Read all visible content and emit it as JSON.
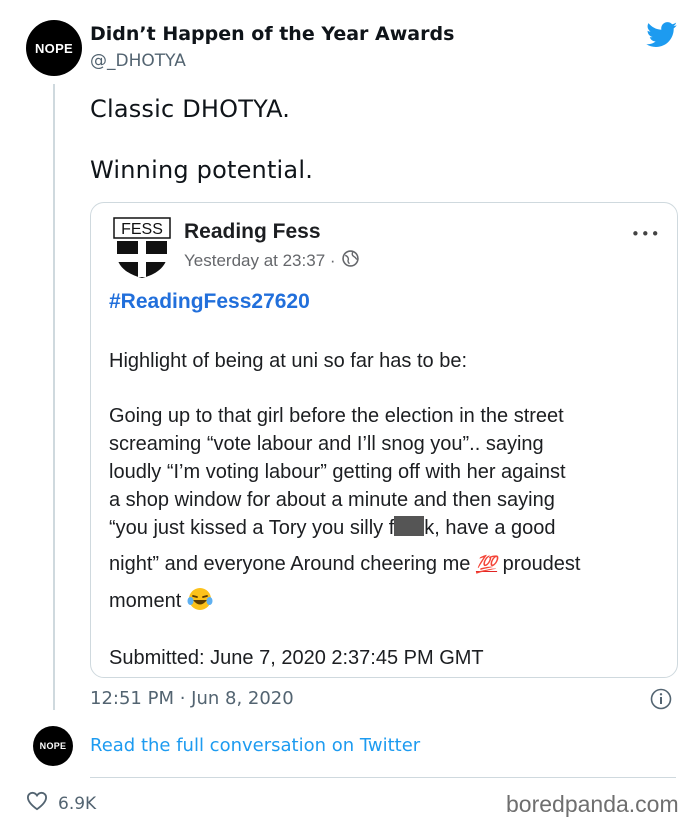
{
  "account": {
    "avatar_text": "NOPE",
    "name": "Didn’t Happen of the Year Awards",
    "handle": "@_DHOTYA"
  },
  "tweet": {
    "line1": "Classic DHOTYA.",
    "line2": "Winning potential.",
    "time": "12:51 PM · Jun 8, 2020"
  },
  "embedded_post": {
    "page_logo_text": "FESS",
    "page_name": "Reading Fess",
    "meta": "Yesterday at 23:37 ·",
    "more": "•••",
    "hashtag": "#ReadingFess27620",
    "intro": "Highlight of being at uni so far has to be:",
    "body_l1": "Going up to that girl before the election in the street",
    "body_l2": "screaming “vote labour and I’ll snog you”.. saying",
    "body_l3": "loudly “I’m voting labour” getting off with her against",
    "body_l4": "a shop window for about a minute and then saying",
    "body_l5a": "“you just kissed a Tory you silly f",
    "body_l5b": "k, have a good",
    "body_l6a": "night” and everyone Around cheering me",
    "body_l6b": "proudest",
    "body_l7": "moment",
    "hundred_emoji": "💯",
    "submitted": "Submitted:  June 7, 2020 2:37:45 PM GMT"
  },
  "footer": {
    "conversation_avatar_text": "NOPE",
    "conversation_link": "Read the full conversation on Twitter",
    "likes": "6.9K",
    "watermark": "boredpanda.com"
  },
  "colors": {
    "twitter_blue": "#1d9bf0",
    "facebook_blue": "#216fdb",
    "muted": "#536471"
  }
}
